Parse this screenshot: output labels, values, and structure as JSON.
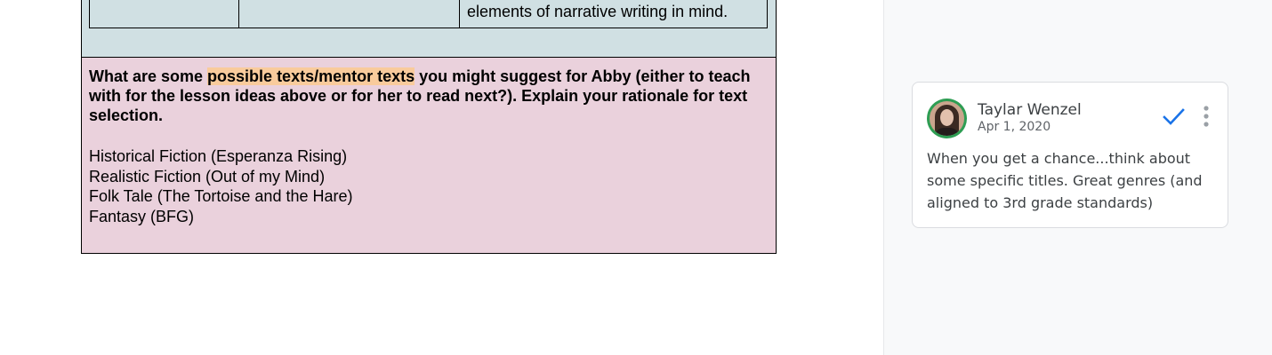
{
  "document": {
    "table_top": {
      "visible_cell_text": "elements of narrative writing in mind."
    },
    "prompt_block": {
      "question_before": "What are some ",
      "question_highlight": "possible texts/mentor texts",
      "question_after": " you might suggest for Abby (either to teach with for the lesson ideas above or for her to read next?). Explain your rationale for text selection.",
      "genres": [
        "Historical Fiction (Esperanza Rising)",
        "Realistic Fiction (Out of my Mind)",
        "Folk Tale (The Tortoise and the Hare)",
        "Fantasy (BFG)"
      ]
    }
  },
  "comment": {
    "author": "Taylar Wenzel",
    "date": "Apr 1, 2020",
    "text": "When you get a chance...think about some specific titles. Great genres (and aligned to 3rd grade standards)",
    "avatar_icon": "user-avatar-photo",
    "resolve_icon": "check-icon",
    "more_icon": "more-vert-icon"
  },
  "colors": {
    "blue_cell": "#d0e0e3",
    "pink_cell": "#ead1dc",
    "highlight": "#f9cb9c",
    "resolve_blue": "#1a73e8",
    "avatar_ring": "#2e9d53"
  }
}
